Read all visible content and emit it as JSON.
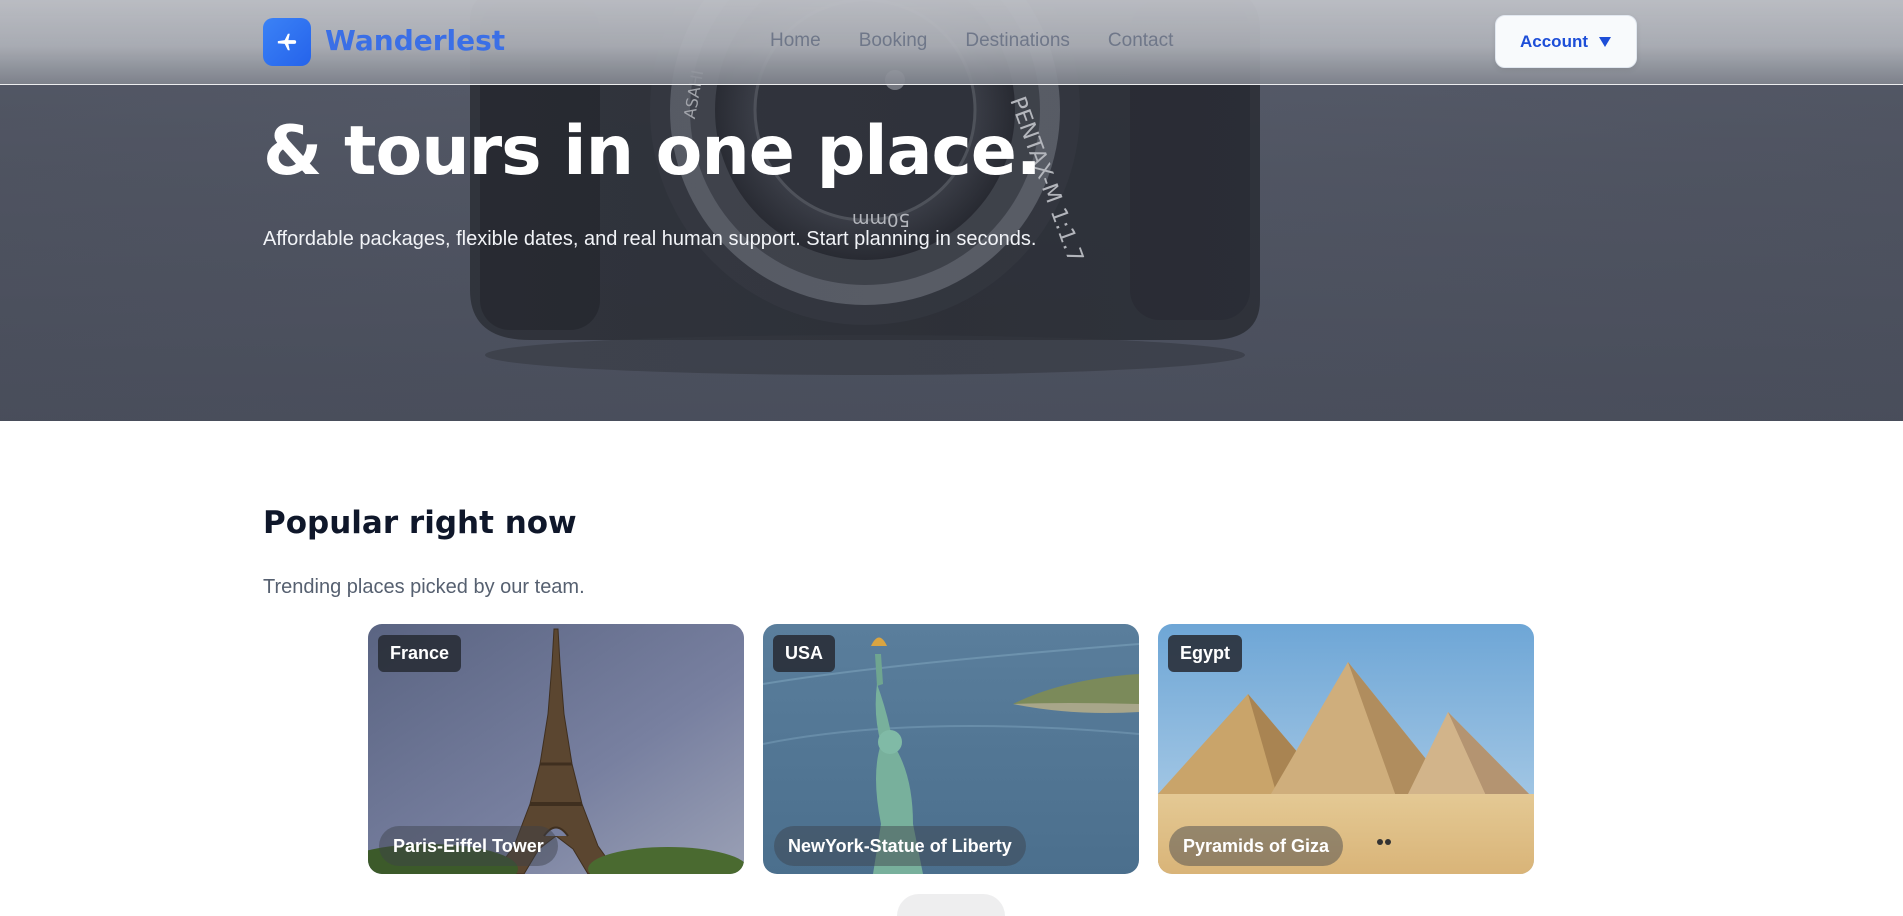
{
  "brand": {
    "name": "Wanderlest",
    "icon": "airplane-icon"
  },
  "nav": {
    "links": [
      "Home",
      "Booking",
      "Destinations",
      "Contact"
    ],
    "account_label": "Account",
    "account_icon": "caret-down-icon"
  },
  "hero": {
    "title": "& tours in one place.",
    "subtitle": "Affordable packages, flexible dates, and real human support. Start planning in seconds."
  },
  "popular": {
    "title": "Popular right now",
    "subtitle": "Trending places picked by our team.",
    "cards": [
      {
        "country": "France",
        "name": "Paris-Eiffel Tower"
      },
      {
        "country": "USA",
        "name": "NewYork-Statue of Liberty"
      },
      {
        "country": "Egypt",
        "name": "Pyramids of Giza"
      }
    ]
  },
  "colors": {
    "accent": "#2563eb",
    "brand_text": "#3b6fe6",
    "heading": "#0f172a"
  }
}
